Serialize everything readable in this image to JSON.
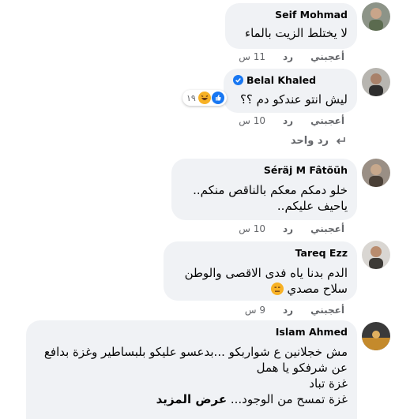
{
  "comments": [
    {
      "name": "Seif Mohmad",
      "lines": [
        "لا يختلط الزيت بالماء"
      ],
      "like": "أعجبني",
      "reply": "رد",
      "time": "11 س"
    },
    {
      "name": "Belal Khaled",
      "verified": true,
      "lines": [
        "ليش انتو عندكو دم ؟؟"
      ],
      "reactions_count": "١٩",
      "like": "أعجبني",
      "reply": "رد",
      "time": "10 س",
      "replies_label": "رد واحد"
    },
    {
      "name": "Séräj M Fâtõüh",
      "lines": [
        "خلو دمكم معكم بالناقص منكم..",
        "ياحيف عليكم.."
      ],
      "like": "أعجبني",
      "reply": "رد",
      "time": "10 س"
    },
    {
      "name": "Tareq Ezz",
      "lines": [
        "الدم بدنا ياه فدى الاقصى والوطن",
        "سلاح مصدي"
      ],
      "like": "أعجبني",
      "reply": "رد",
      "time": "9 س"
    },
    {
      "name": "Islam Ahmed",
      "lines": [
        "مش خجلانين ع شواربكو ...بدعسو عليكو بلبساطير وغزة بدافع",
        "عن شرفكو يا همل",
        "غزة تباد",
        "غزة تمسح من الوجود..."
      ],
      "see_more": "عرض المزيد"
    }
  ],
  "colors": {
    "bubble": "#f0f2f5",
    "secondary_text": "#65676b",
    "verified_blue": "#1877f2"
  }
}
